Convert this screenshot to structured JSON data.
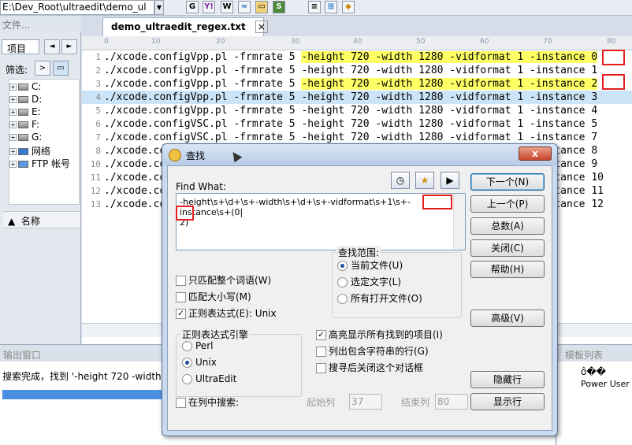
{
  "toolbar": {
    "path": "E:\\Dev_Root\\ultraedit\\demo_ul",
    "icons": [
      "google-icon",
      "yahoo-icon",
      "wikipedia-icon",
      "web-icon",
      "folder-icon",
      "php-icon",
      "search-icon",
      "windows-icon",
      "flag-icon"
    ],
    "icon_glyphs": [
      "G",
      "Y!",
      "W",
      "≈",
      "▭",
      "S",
      "≡",
      "⊞",
      "◆"
    ]
  },
  "side": {
    "title": "文件...",
    "tab": "项目",
    "filter_label": "筛选:",
    "filter_btn": ">",
    "tree": [
      "C:",
      "D:",
      "E:",
      "F:",
      "G:",
      "网络",
      "FTP 帐号"
    ],
    "name_header": "名称"
  },
  "tab": {
    "label": "demo_ultraedit_regex.txt",
    "close": "×"
  },
  "ruler": [
    "0",
    "10",
    "20",
    "30",
    "40",
    "50",
    "60",
    "70",
    "80"
  ],
  "editor": {
    "lines": [
      {
        "n": "1",
        "pre": "./xcode.configVpp.pl -frmrate 5 ",
        "hl": "-height 720 -width 1280 -vidformat 1 -instance ",
        "end": "0",
        "mode": "hl"
      },
      {
        "n": "2",
        "pre": "./xcode.configVpp.pl -frmrate 5 ",
        "hl": "-height 720 -width 1280 -vidformat 1 -instance ",
        "end": "1",
        "mode": ""
      },
      {
        "n": "3",
        "pre": "./xcode.configVpp.pl -frmrate 5 ",
        "hl": "-height 720 -width 1280 -vidformat 1 -instance ",
        "end": "2",
        "mode": "hl"
      },
      {
        "n": "4",
        "pre": "./xcode.configVpp.pl -frmrate 5 ",
        "hl": "-height 720 -width 1280 -vidformat 1 -instance ",
        "end": "3",
        "mode": "cur"
      },
      {
        "n": "5",
        "pre": "./xcode.configVpp.pl -frmrate 5 ",
        "hl": "-height 720 -width 1280 -vidformat 1 -instance ",
        "end": "4",
        "mode": ""
      },
      {
        "n": "6",
        "pre": "./xcode.configVSC.pl -frmrate 5 ",
        "hl": "-height 720 -width 1280 -vidformat 1 -instance ",
        "end": "5",
        "mode": ""
      },
      {
        "n": "7",
        "pre": "./xcode.configVSC.pl -frmrate 5 ",
        "hl": "-height 720 -width 1280 -vidformat 1 -instance ",
        "end": "7",
        "mode": ""
      },
      {
        "n": "8",
        "pre": "./xcode.configVSC.pl -frmrate 5 ",
        "hl": "-height 720 -width 1280 -vidformat 1 -instance ",
        "end": "8",
        "mode": ""
      },
      {
        "n": "10",
        "pre": "./xcode.configVSC.pl -frmrate 5 ",
        "hl": "-height 720 -width 1280 -vidformat 1 -instance ",
        "end": "9",
        "mode": ""
      },
      {
        "n": "11",
        "pre": "./xcode.configVSC.pl -frmrate 5 ",
        "hl": "-height 720 -width 1280 -vidformat 1 -instance ",
        "end": "10",
        "mode": ""
      },
      {
        "n": "12",
        "pre": "./xcode.configVSC.pl -frmrate 5 ",
        "hl": "-height 720 -width 1280 -vidformat 1 -instance ",
        "end": "11",
        "mode": ""
      },
      {
        "n": "13",
        "pre": "./xcode.configVSC.pl -frmrate 5 ",
        "hl": "-height 720 -width 1280 -vidformat 1 -instance ",
        "end": "12",
        "mode": ""
      }
    ]
  },
  "output": {
    "title": "输出窗口",
    "text": "搜索完成，找到 '-height 720 -width 1280"
  },
  "template": {
    "title": "模板列表",
    "item1": "ô��",
    "item2": "Power User"
  },
  "dialog": {
    "title": "查找",
    "close": "x",
    "find_label": "Find What:",
    "find_value": "-height\\s+\\d+\\s+-width\\s+\\d+\\s+-vidformat\\s+1\\s+-instance\\s+(0|2)",
    "find_line1": "-height\\s+\\d+\\s+-width\\s+\\d+\\s+-vidformat\\s+1\\s+-instance\\s+(0|",
    "find_line2": "2)",
    "btn_next": "下一个(N)",
    "btn_prev": "上一个(P)",
    "btn_count": "总数(A)",
    "btn_close": "关闭(C)",
    "btn_help": "帮助(H)",
    "btn_adv": "高级(V)",
    "btn_hide": "隐藏行",
    "btn_show": "显示行",
    "opt_word": "只匹配整个词语(W)",
    "opt_case": "匹配大小写(M)",
    "opt_regex": "正则表达式(E): Unix",
    "scope_title": "查找范围:",
    "scope": [
      "当前文件(U)",
      "选定文字(L)",
      "所有打开文件(O)"
    ],
    "engine_title": "正则表达式引擎",
    "engines": [
      "Perl",
      "Unix",
      "UltraEdit"
    ],
    "opt_hl": "高亮显示所有找到的项目(I)",
    "opt_list": "列出包含字符串的行(G)",
    "opt_closeafter": "搜寻后关闭这个对话框",
    "col_search": "在列中搜索:",
    "start_col_label": "起始列",
    "start_col": "37",
    "end_col_label": "结束列",
    "end_col": "80"
  }
}
